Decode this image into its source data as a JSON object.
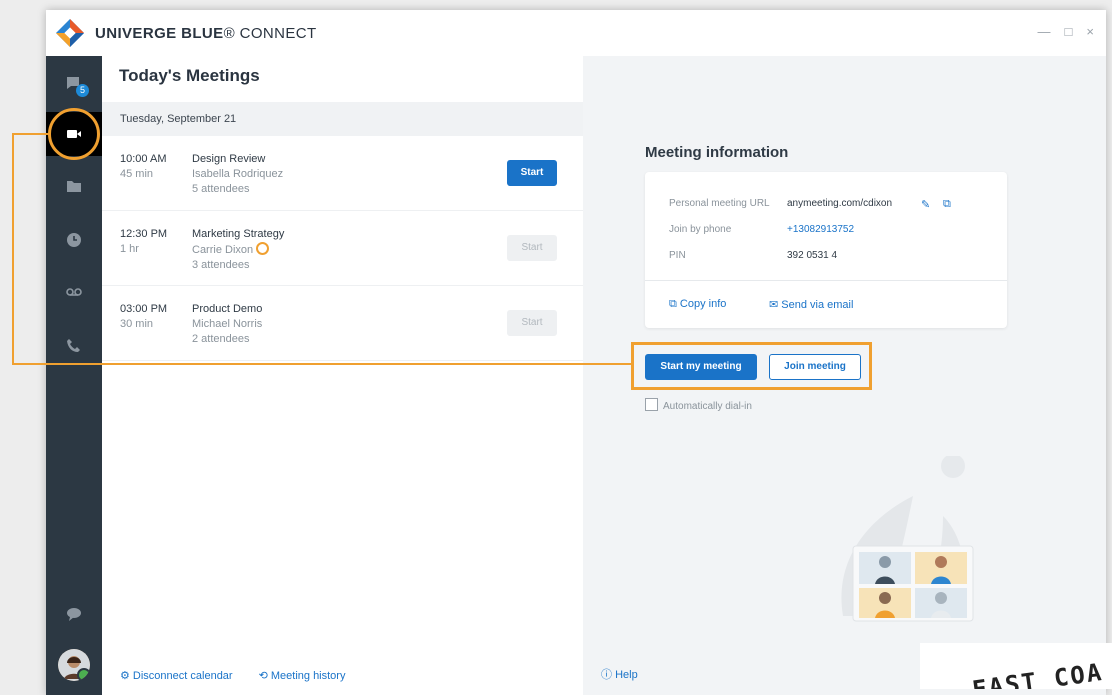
{
  "app": {
    "title_bold": "UNIVERGE BLUE",
    "title_reg": "® CONNECT",
    "win_min": "—",
    "win_max": "□",
    "win_close": "×"
  },
  "sidebar": {
    "chat_badge": "5",
    "items": [
      "chat",
      "meetings",
      "files",
      "history",
      "voicemail",
      "phone",
      "feedback"
    ]
  },
  "meetings_pane": {
    "title": "Today's Meetings",
    "date": "Tuesday, September 21",
    "meetings": [
      {
        "time": "10:00 AM",
        "duration": "45 min",
        "name": "Design Review",
        "host": "Isabella Rodriquez",
        "attendees": "5 attendees",
        "button": "Start"
      },
      {
        "time": "12:30 PM",
        "duration": "1 hr",
        "name": "Marketing Strategy",
        "host": "Carrie Dixon",
        "attendees": "3 attendees",
        "button": "Start"
      },
      {
        "time": "03:00 PM",
        "duration": "30 min",
        "name": "Product Demo",
        "host": "Michael Norris",
        "attendees": "2 attendees",
        "button": "Start"
      }
    ],
    "footer": {
      "disconnect": "Disconnect calendar",
      "history": "Meeting history"
    }
  },
  "meeting_info": {
    "title": "Meeting information",
    "url_label": "Personal meeting URL",
    "url_value": "anymeeting.com/cdixon",
    "phone_label": "Join by phone",
    "phone_value": "+13082913752",
    "pin_label": "PIN",
    "pin_value": "392 0531 4",
    "copy_info": "Copy info",
    "send_email": "Send via email",
    "start_my_meeting": "Start my meeting",
    "join_meeting": "Join meeting",
    "auto_dial": "Automatically dial-in",
    "help": "Help"
  },
  "stamp": {
    "text": "EAST COA"
  },
  "colors": {
    "accent": "#1a73c8",
    "sidebar": "#2c3843",
    "annotation": "#f0a030"
  }
}
